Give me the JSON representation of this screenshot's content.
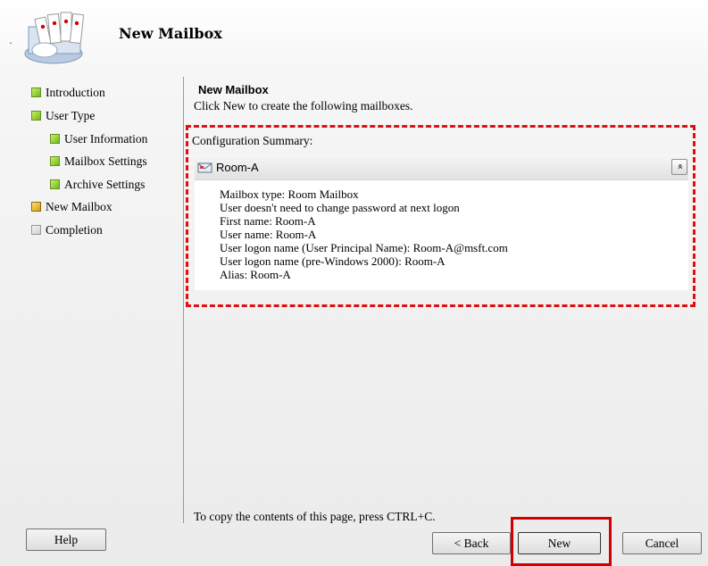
{
  "header": {
    "title": "New Mailbox"
  },
  "nav": {
    "items": [
      {
        "label": "Introduction",
        "status": "complete"
      },
      {
        "label": "User Type",
        "status": "complete"
      },
      {
        "label": "User Information",
        "status": "complete"
      },
      {
        "label": "Mailbox Settings",
        "status": "complete"
      },
      {
        "label": "Archive Settings",
        "status": "complete"
      },
      {
        "label": "New Mailbox",
        "status": "current"
      },
      {
        "label": "Completion",
        "status": "pending"
      }
    ]
  },
  "content": {
    "title": "New Mailbox",
    "description": "Click New to create the following mailboxes.",
    "summary_heading": "Configuration Summary:",
    "item_name": "Room-A",
    "item_icon": "mailbox-icon",
    "collapse_glyph": "»",
    "lines": [
      "Mailbox type: Room Mailbox",
      "User doesn't need to change password at next logon",
      "First name: Room-A",
      "User name: Room-A",
      "User logon name (User Principal Name): Room-A@msft.com",
      "User logon name (pre-Windows 2000): Room-A",
      "Alias: Room-A"
    ],
    "copy_hint": "To copy the contents of this page, press CTRL+C."
  },
  "buttons": {
    "help": "Help",
    "back": "< Back",
    "new": "New",
    "cancel": "Cancel"
  },
  "colors": {
    "highlight": "#e01010",
    "complete": "#6fb81c",
    "current": "#d79a14",
    "pending": "#cfcfcf"
  }
}
